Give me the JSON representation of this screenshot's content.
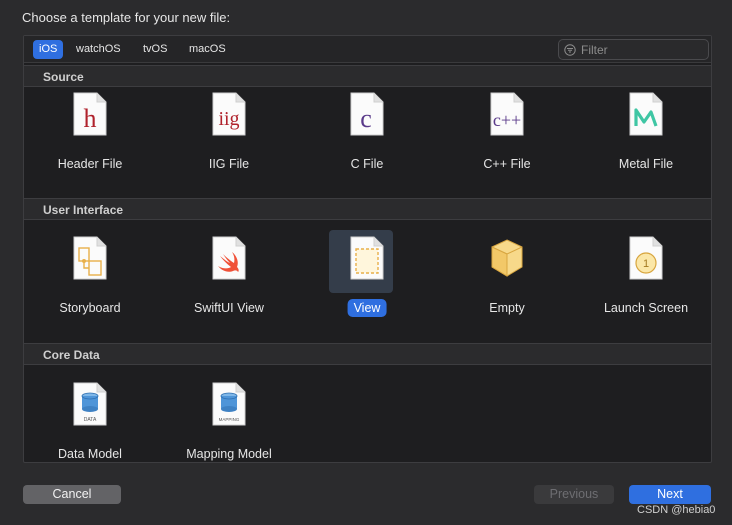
{
  "dialog": {
    "title": "Choose a template for your new file:"
  },
  "platform_tabs": [
    "iOS",
    "watchOS",
    "tvOS",
    "macOS"
  ],
  "selected_platform": "iOS",
  "filter": {
    "placeholder": "Filter",
    "value": ""
  },
  "sections": [
    {
      "title": "Source",
      "templates": [
        {
          "label": "Header File",
          "icon": "header-file-icon",
          "glyph": "h"
        },
        {
          "label": "IIG File",
          "icon": "iig-file-icon",
          "glyph": "iig"
        },
        {
          "label": "C File",
          "icon": "c-file-icon",
          "glyph": "c"
        },
        {
          "label": "C++ File",
          "icon": "cpp-file-icon",
          "glyph": "c++"
        },
        {
          "label": "Metal File",
          "icon": "metal-file-icon",
          "glyph": "M"
        }
      ]
    },
    {
      "title": "User Interface",
      "templates": [
        {
          "label": "Storyboard",
          "icon": "storyboard-icon"
        },
        {
          "label": "SwiftUI View",
          "icon": "swift-icon"
        },
        {
          "label": "View",
          "icon": "xib-view-icon",
          "selected": true
        },
        {
          "label": "Empty",
          "icon": "empty-box-icon"
        },
        {
          "label": "Launch Screen",
          "icon": "launch-screen-icon",
          "glyph": "1"
        }
      ]
    },
    {
      "title": "Core Data",
      "templates": [
        {
          "label": "Data Model",
          "icon": "data-model-icon",
          "glyph": "DATA"
        },
        {
          "label": "Mapping Model",
          "icon": "mapping-model-icon",
          "glyph": "MAPPING"
        }
      ]
    }
  ],
  "buttons": {
    "cancel": "Cancel",
    "previous": "Previous",
    "next": "Next"
  },
  "watermark": "CSDN @hebia0",
  "colors": {
    "accent": "#2f6fe0",
    "panel_bg": "#1e1e20",
    "section_header_bg": "#2b2b2d",
    "header_letter": "#b0222c",
    "c_letter": "#5a3a8a",
    "metal": "#3fc6a4",
    "swift": "#f05138",
    "storyboard": "#e8b04a"
  }
}
